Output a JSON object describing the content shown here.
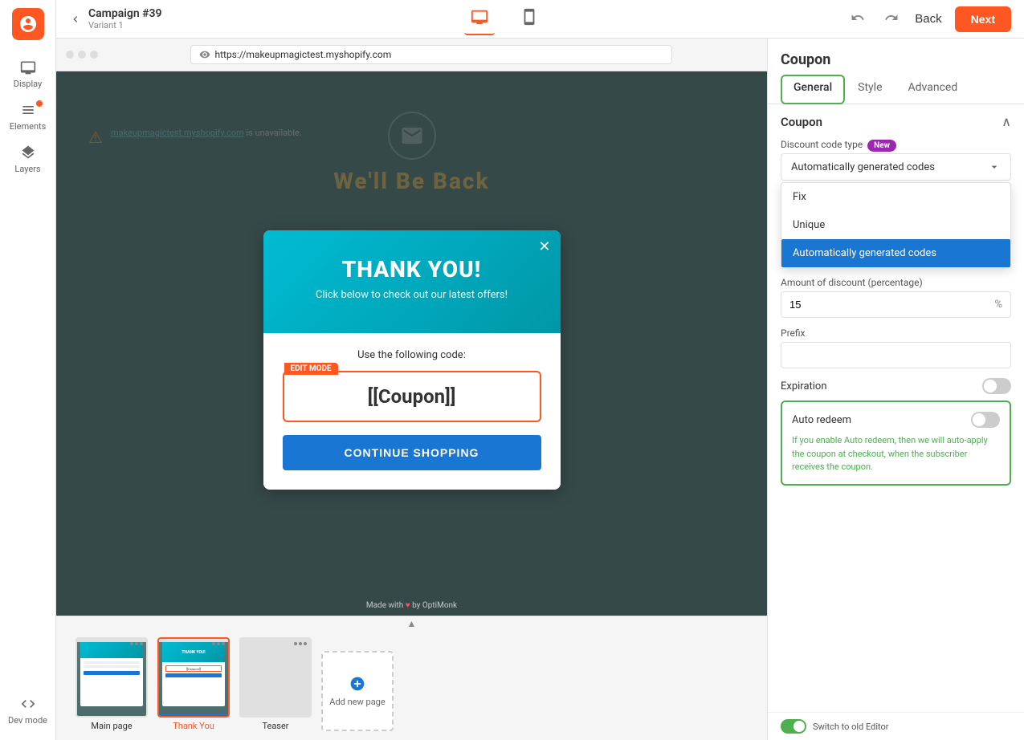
{
  "app": {
    "logo_label": "OptiMonk",
    "campaign_name": "Campaign #39",
    "variant": "Variant 1",
    "url": "https://makeupmagictest.myshopify.com"
  },
  "topbar": {
    "back_label": "Back",
    "next_label": "Next",
    "device_desktop": "Desktop",
    "device_mobile": "Mobile"
  },
  "sidebar": {
    "display_label": "Display",
    "elements_label": "Elements",
    "layers_label": "Layers",
    "devmode_label": "Dev mode"
  },
  "popup": {
    "title": "THANK YOU!",
    "subtitle": "Click below to check out our latest offers!",
    "code_label": "Use the following code:",
    "coupon_placeholder": "[[Coupon]]",
    "edit_mode_badge": "EDIT MODE",
    "continue_btn": "CONTINUE SHOPPING"
  },
  "thumbnails": {
    "scroll_up": "▲",
    "items": [
      {
        "label": "Main page",
        "active": false
      },
      {
        "label": "Thank You",
        "active": true
      },
      {
        "label": "Teaser",
        "active": false
      }
    ],
    "add_label": "Add new page"
  },
  "credit": "Made with ♥ by OptiMonk",
  "right_panel": {
    "title": "Coupon",
    "tabs": [
      {
        "label": "General",
        "active": true
      },
      {
        "label": "Style",
        "active": false
      },
      {
        "label": "Advanced",
        "active": false
      }
    ],
    "coupon_section": {
      "title": "Coupon",
      "discount_code_type_label": "Discount code type",
      "new_badge": "New",
      "dropdown_selected": "Automatically generated codes",
      "dropdown_options": [
        {
          "label": "Fix",
          "selected": false
        },
        {
          "label": "Unique",
          "selected": false
        },
        {
          "label": "Automatically generated codes",
          "selected": true
        }
      ],
      "amount_label": "Amount of discount (percentage)",
      "amount_value": "15",
      "amount_suffix": "%",
      "prefix_label": "Prefix",
      "prefix_value": "",
      "prefix_placeholder": "",
      "expiration_label": "Expiration",
      "expiration_on": false,
      "auto_redeem_label": "Auto redeem",
      "auto_redeem_on": false,
      "auto_redeem_desc": "If you enable Auto redeem, then we will auto-apply the coupon at checkout, when the subscriber receives the coupon."
    }
  },
  "switch_editor": "Switch to old Editor"
}
